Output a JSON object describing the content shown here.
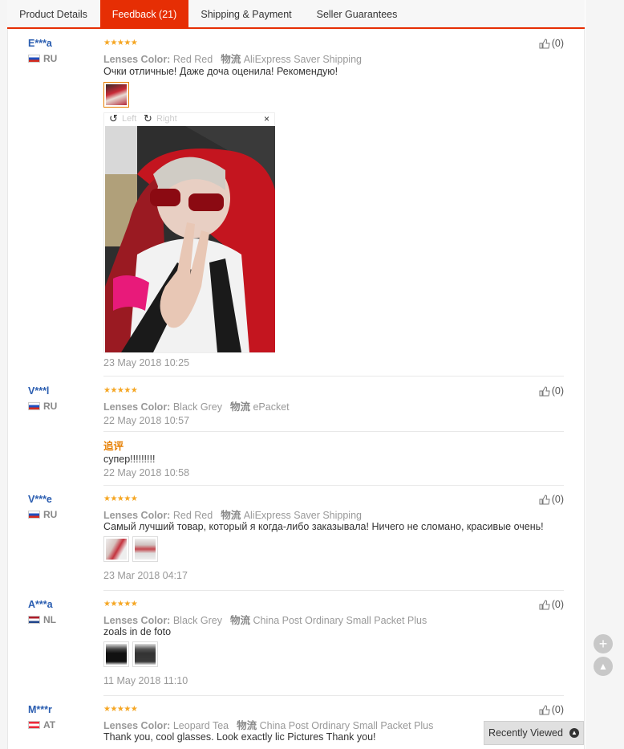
{
  "tabs": [
    {
      "label": "Product Details"
    },
    {
      "label": "Feedback (21)"
    },
    {
      "label": "Shipping & Payment"
    },
    {
      "label": "Seller Guarantees"
    }
  ],
  "common": {
    "stars": "★★★★★",
    "lenses_label": "Lenses Color:",
    "ship_label": "物流",
    "like_count": "(0)"
  },
  "reviews": [
    {
      "user": "E***a",
      "country": "RU",
      "color": "Red Red",
      "shipping": "AliExpress Saver Shipping",
      "text": "Очки отличные! Даже доча оценила! Рекомендую!",
      "date": "23 May 2018 10:25"
    },
    {
      "user": "V***l",
      "country": "RU",
      "color": "Black Grey",
      "shipping": "ePacket",
      "date": "22 May 2018 10:57",
      "additional_title": "追评",
      "additional_text": "супер!!!!!!!!!",
      "additional_date": "22 May 2018 10:58"
    },
    {
      "user": "V***e",
      "country": "RU",
      "color": "Red Red",
      "shipping": "AliExpress Saver Shipping",
      "text": "Самый лучший товар, который я когда-либо заказывала! Ничего не сломано, красивые очень!",
      "date": "23 Mar 2018 04:17"
    },
    {
      "user": "A***a",
      "country": "NL",
      "color": "Black Grey",
      "shipping": "China Post Ordinary Small Packet Plus",
      "text": "zoals in de foto",
      "date": "11 May 2018 11:10"
    },
    {
      "user": "M***r",
      "country": "AT",
      "color": "Leopard Tea",
      "shipping": "China Post Ordinary Small Packet Plus",
      "text": "Thank you, cool glasses. Look exactly lic Pictures Thank you!"
    }
  ],
  "viewer": {
    "rotate_left": "Left",
    "rotate_right": "Right",
    "close": "×"
  },
  "recently_viewed": "Recently Viewed",
  "colors": {
    "accent": "#e62e04",
    "star": "#f5a623",
    "user_link": "#2a5db0"
  }
}
